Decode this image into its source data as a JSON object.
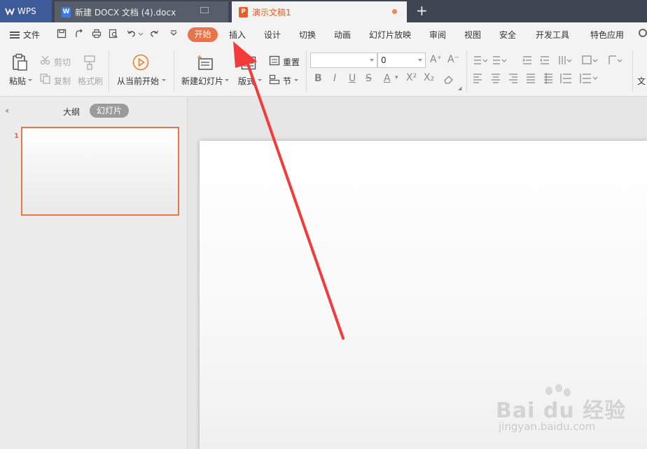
{
  "tabs": {
    "wps_label": "WPS",
    "doc_label": "新建 DOCX 文档 (4).docx",
    "doc_icon": "W",
    "ppt_label": "演示文稿1",
    "ppt_icon": "P",
    "new_tab": "+"
  },
  "menu": {
    "file": "文件",
    "active": "开始",
    "items": [
      "插入",
      "设计",
      "切换",
      "动画",
      "幻灯片放映",
      "审阅",
      "视图",
      "安全",
      "开发工具",
      "特色应用"
    ]
  },
  "ribbon": {
    "paste": "粘贴",
    "cut": "剪切",
    "copy": "复制",
    "format_painter": "格式刷",
    "play_from_current": "从当前开始",
    "new_slide": "新建幻灯片",
    "layout": "版式",
    "reset": "重置",
    "section": "节",
    "font_size": "0",
    "cut_left_label": "文"
  },
  "left_panel": {
    "outline_tab": "大纲",
    "slides_tab": "幻灯片",
    "slide_number": "1"
  },
  "watermark": {
    "brand": "Bai du 经验",
    "url": "jingyan.baidu.com"
  },
  "colors": {
    "accent": "#e8744c",
    "tabbar": "#3f4553",
    "wps_tab": "#3d5a99",
    "annotation_arrow": "#f23b3b"
  }
}
